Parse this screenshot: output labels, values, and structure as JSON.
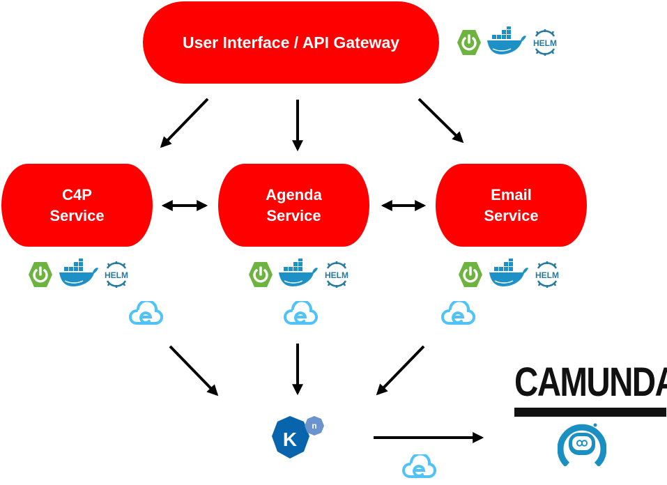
{
  "gateway": {
    "label": "User Interface / API Gateway"
  },
  "services": [
    {
      "label": "C4P\nService"
    },
    {
      "label": "Agenda\nService"
    },
    {
      "label": "Email\nService"
    }
  ],
  "icons": {
    "spring": "spring-boot-icon",
    "docker": "docker-icon",
    "helm": "helm-icon",
    "helm_text": "HELM",
    "cloudevents": "cloudevents-icon",
    "knative": "knative-icon",
    "knative_text": "K",
    "knative_badge": "n",
    "camunda_robot": "camunda-robot-icon"
  },
  "camunda": {
    "logo_text": "CAMUNDA"
  },
  "colors": {
    "node": "#ff0000",
    "spring": "#6db33f",
    "docker": "#1d91c6",
    "helm": "#277a9f",
    "cloudevents": "#4fc3f7",
    "knative": "#0865ad",
    "knative_badge": "#6b94ce",
    "camunda_robot": "#1a8fc2"
  }
}
